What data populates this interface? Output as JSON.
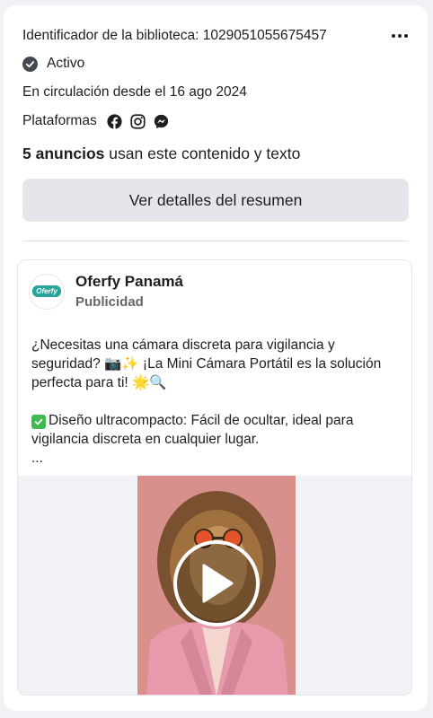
{
  "library": {
    "id_text": "Identificador de la biblioteca: 1029051055675457"
  },
  "status": {
    "label": "Activo"
  },
  "circulation": {
    "text": "En circulación desde el 16 ago 2024"
  },
  "platforms": {
    "label": "Plataformas",
    "icons": [
      "facebook-icon",
      "instagram-icon",
      "messenger-icon"
    ]
  },
  "ads_count": {
    "bold": "5 anuncios",
    "rest": " usan este contenido y texto"
  },
  "summary_button": {
    "label": "Ver detalles del resumen"
  },
  "ad": {
    "page_name": "Oferfy Panamá",
    "sponsored": "Publicidad",
    "avatar_logo": "Oferfy",
    "text_line1": "¿Necesitas una cámara discreta para vigilancia y seguridad? 📷✨ ¡La Mini Cámara Portátil es la solución perfecta para ti! 🌟🔍",
    "text_line2": "Diseño ultracompacto: Fácil de ocultar, ideal para vigilancia discreta en cualquier lugar.",
    "text_more": "..."
  },
  "colors": {
    "facebook": "#1c1e21",
    "check_green": "#3fb950",
    "button_bg": "#e4e6eb",
    "video_bg": "#d8908c"
  }
}
